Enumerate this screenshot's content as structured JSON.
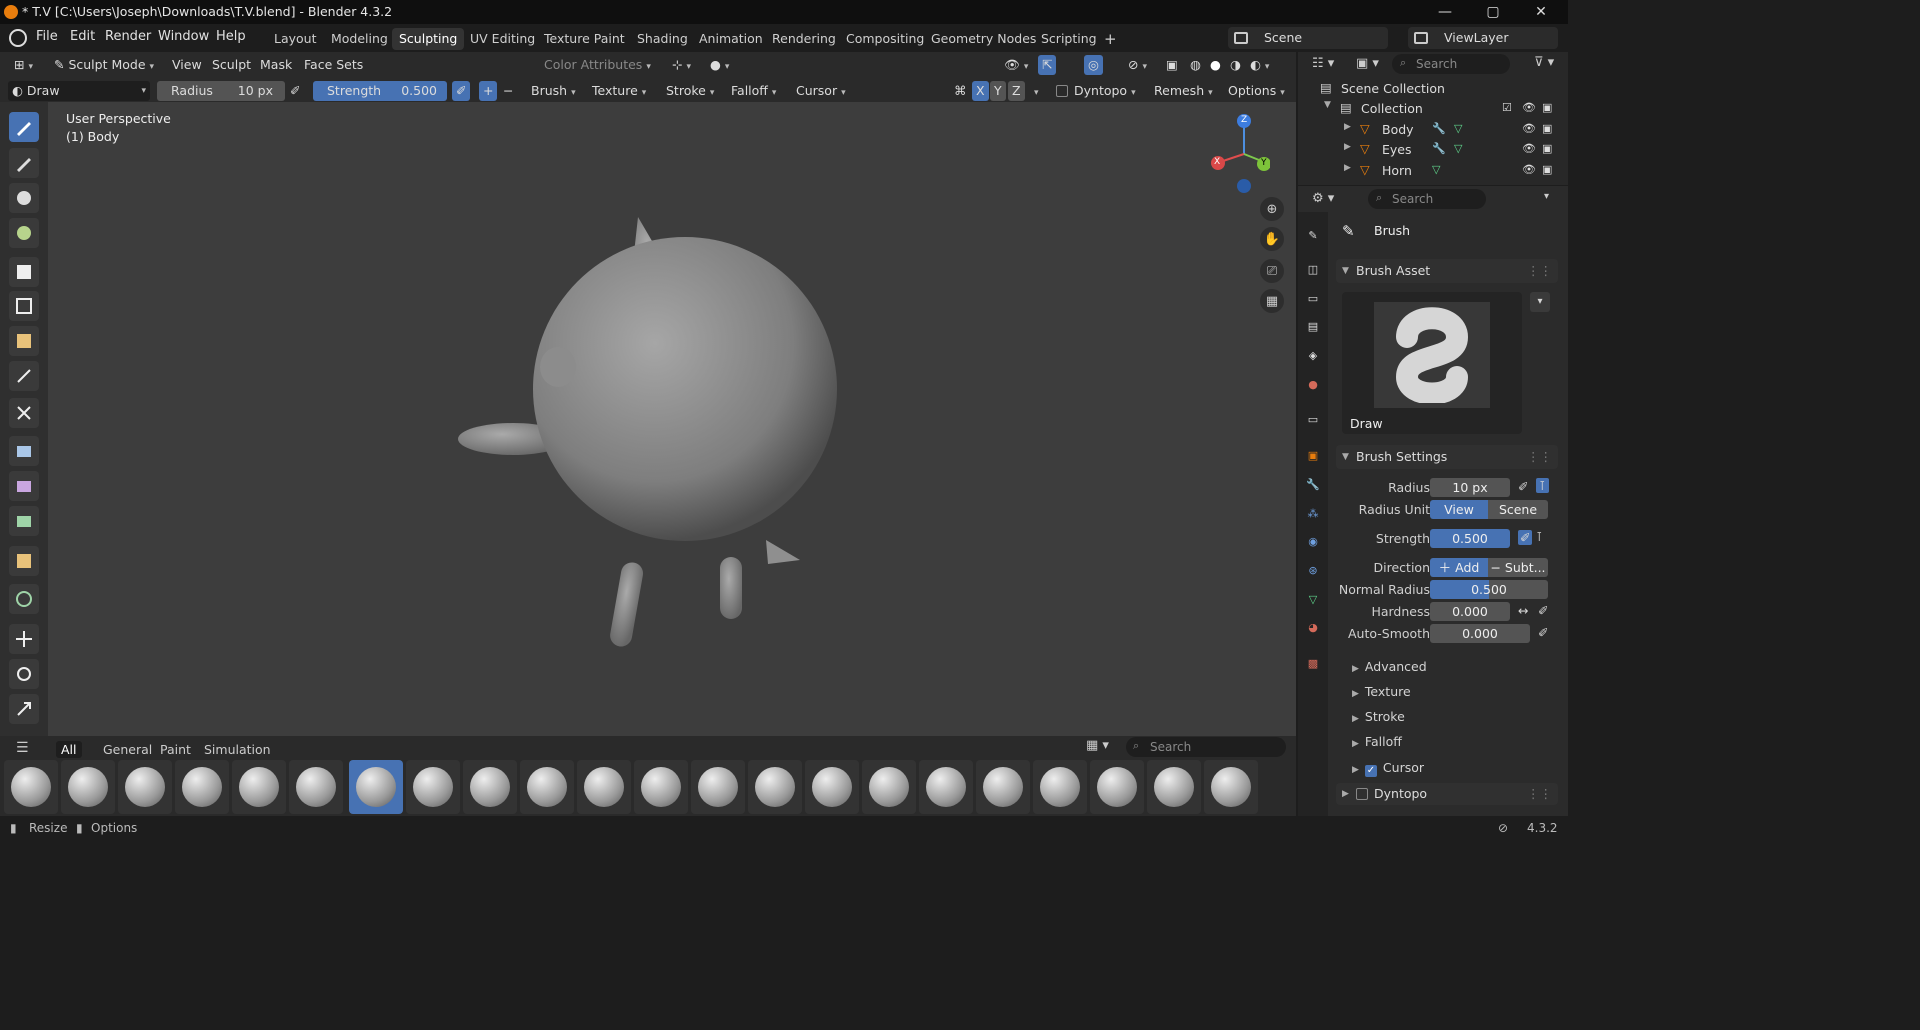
{
  "window": {
    "title": "* T.V [C:\\Users\\Joseph\\Downloads\\T.V.blend] - Blender 4.3.2",
    "min": "—",
    "max": "▢",
    "close": "✕"
  },
  "menu": {
    "items": [
      "File",
      "Edit",
      "Render",
      "Window",
      "Help"
    ],
    "workspaces": [
      "Layout",
      "Modeling",
      "Sculpting",
      "UV Editing",
      "Texture Paint",
      "Shading",
      "Animation",
      "Rendering",
      "Compositing",
      "Geometry Nodes",
      "Scripting"
    ],
    "active_workspace": "Sculpting",
    "add": "+",
    "scene": "Scene",
    "view_layer": "ViewLayer"
  },
  "header": {
    "mode": "Sculpt Mode",
    "menus": [
      "View",
      "Sculpt",
      "Mask",
      "Face Sets"
    ],
    "color_attributes": "Color Attributes"
  },
  "toolsettings": {
    "brush": "Draw",
    "radius_label": "Radius",
    "radius_value": "10 px",
    "strength_label": "Strength",
    "strength_value": "0.500",
    "menus": [
      "Brush",
      "Texture",
      "Stroke",
      "Falloff",
      "Cursor"
    ],
    "axes": [
      "X",
      "Y",
      "Z"
    ],
    "dyntopo": "Dyntopo",
    "remesh": "Remesh",
    "options": "Options"
  },
  "viewport": {
    "perspective": "User Perspective",
    "object": "(1) Body",
    "gizmo": {
      "z": "Z",
      "x": "X",
      "y": "Y"
    }
  },
  "assetbar": {
    "tabs": [
      "All",
      "General",
      "Paint",
      "Simulation"
    ],
    "active_tab": "All",
    "search_placeholder": "Search"
  },
  "statusbar": {
    "resize": "Resize",
    "options": "Options",
    "version": "4.3.2"
  },
  "outliner": {
    "search_placeholder": "Search",
    "scene_collection": "Scene Collection",
    "collection": "Collection",
    "objects": [
      "Body",
      "Eyes",
      "Horn"
    ]
  },
  "properties": {
    "search_placeholder": "Search",
    "context": "Brush",
    "brush_asset": {
      "header": "Brush Asset",
      "name": "Draw"
    },
    "brush_settings": {
      "header": "Brush Settings",
      "radius": {
        "label": "Radius",
        "value": "10 px"
      },
      "radius_unit": {
        "label": "Radius Unit",
        "options": [
          "View",
          "Scene"
        ],
        "active": "View"
      },
      "strength": {
        "label": "Strength",
        "value": "0.500"
      },
      "direction": {
        "label": "Direction",
        "add": "Add",
        "subtract": "Subt..."
      },
      "normal_radius": {
        "label": "Normal Radius",
        "value": "0.500"
      },
      "hardness": {
        "label": "Hardness",
        "value": "0.000"
      },
      "auto_smooth": {
        "label": "Auto-Smooth",
        "value": "0.000"
      }
    },
    "subpanels": [
      "Advanced",
      "Texture",
      "Stroke",
      "Falloff",
      "Cursor"
    ],
    "dyntopo": "Dyntopo"
  },
  "colors": {
    "accent": "#4772b3",
    "orange": "#e87d0d"
  }
}
